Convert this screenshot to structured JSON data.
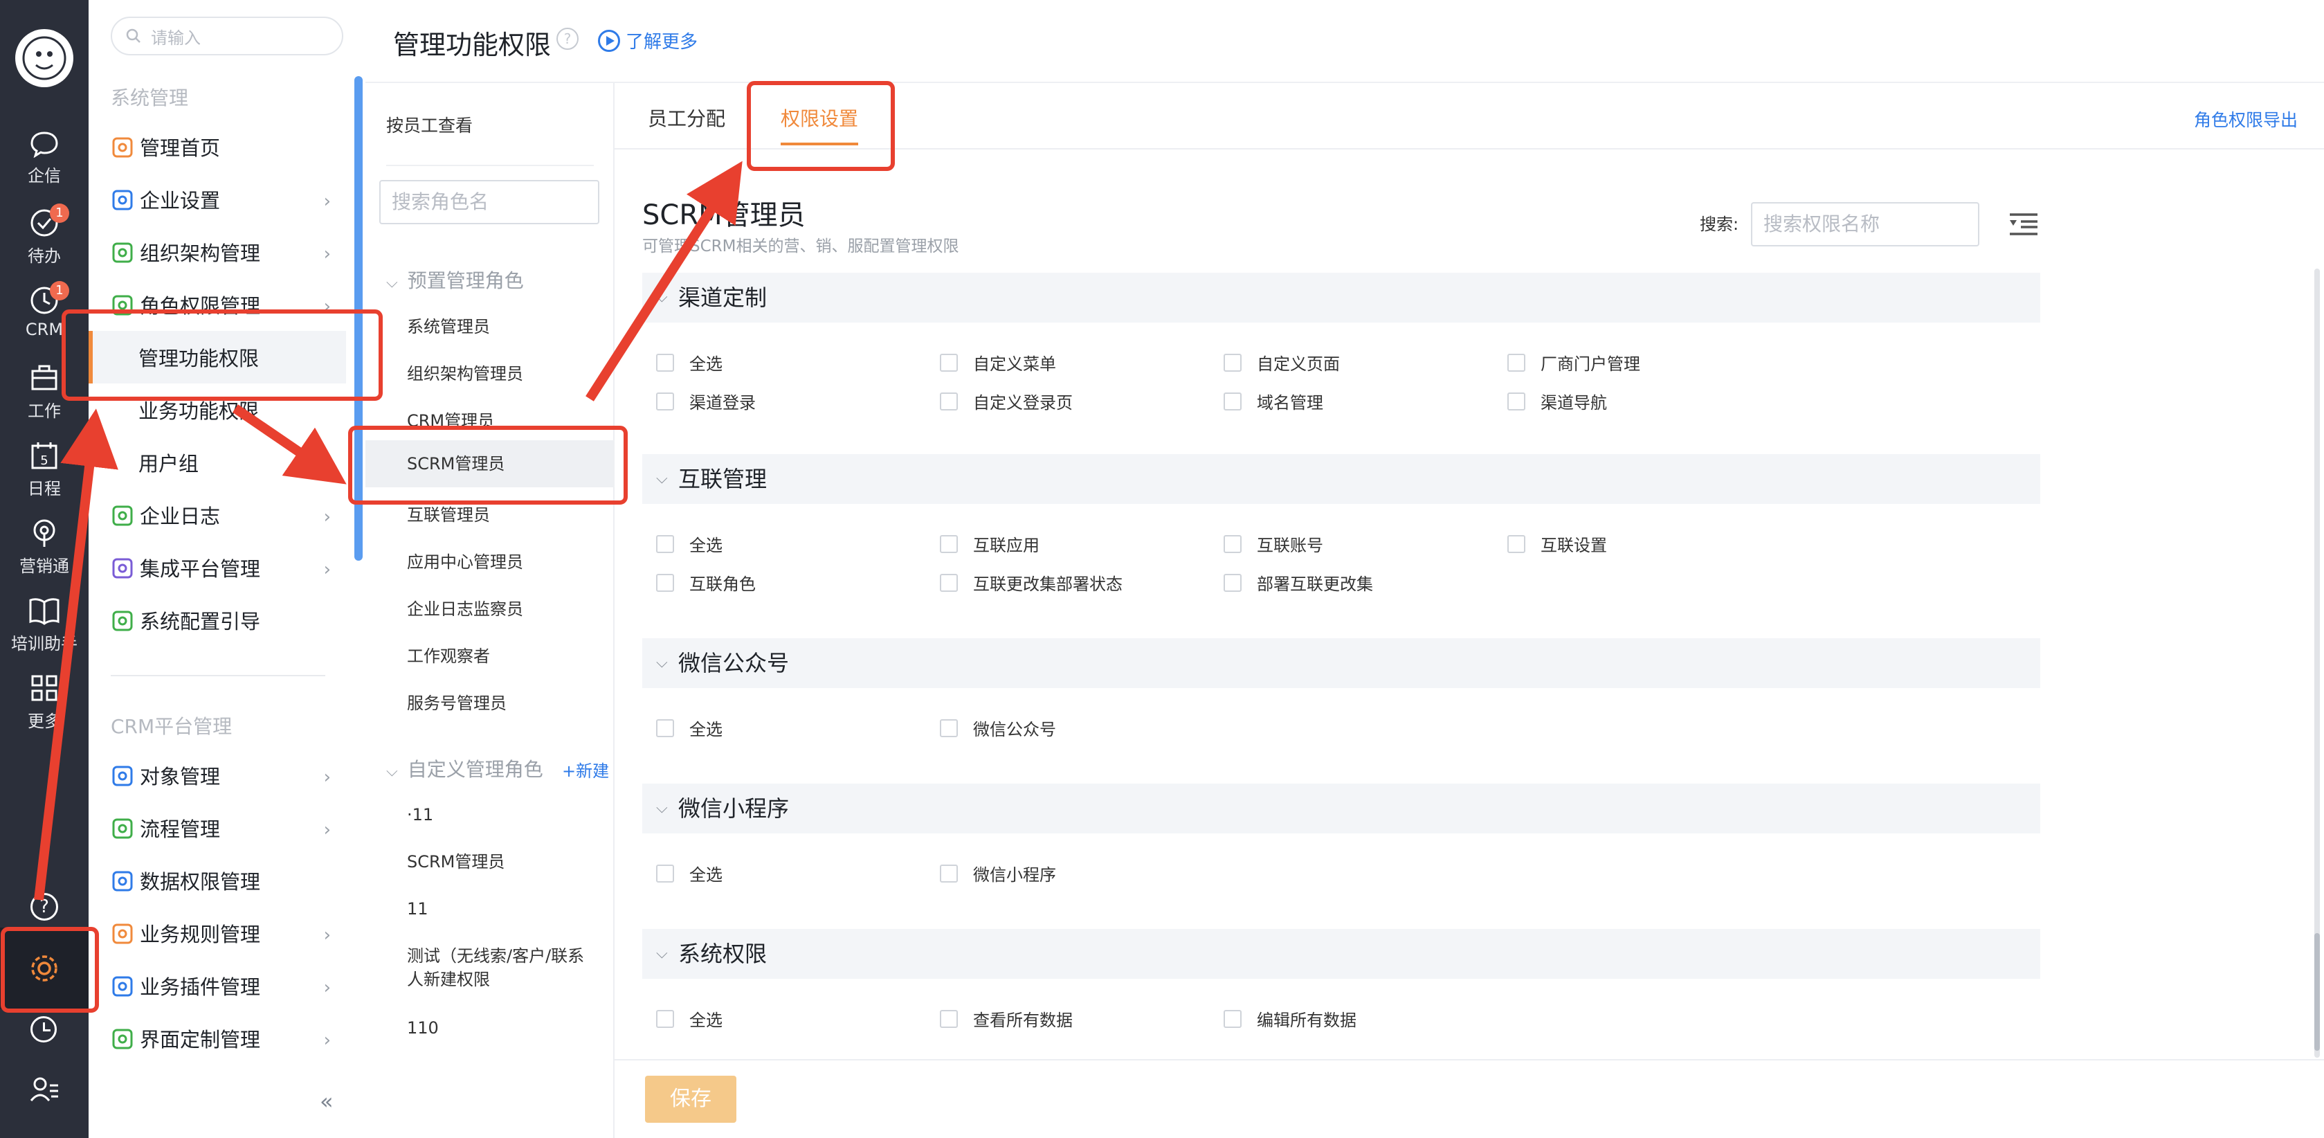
{
  "rail": {
    "items": [
      {
        "icon": "chat-bubble-icon",
        "label": "企信",
        "badge": ""
      },
      {
        "icon": "checkmark-circle-icon",
        "label": "待办",
        "badge": "1"
      },
      {
        "icon": "clock-icon",
        "label": "CRM",
        "badge": "1"
      },
      {
        "icon": "briefcase-icon",
        "label": "工作",
        "badge": ""
      },
      {
        "icon": "calendar-icon",
        "label": "日程",
        "badge": ""
      },
      {
        "icon": "broadcast-icon",
        "label": "营销通",
        "badge": ""
      },
      {
        "icon": "book-icon",
        "label": "培训助手",
        "badge": ""
      },
      {
        "icon": "grid-icon",
        "label": "更多",
        "badge": ""
      }
    ],
    "calendar_day": "5"
  },
  "sidenav": {
    "search_placeholder": "请输入",
    "group1_title": "系统管理",
    "group1_items": [
      {
        "label": "管理首页",
        "icon": "home-icon",
        "chevron": false
      },
      {
        "label": "企业设置",
        "icon": "building-icon",
        "chevron": true
      },
      {
        "label": "组织架构管理",
        "icon": "org-tree-icon",
        "chevron": true
      },
      {
        "label": "角色权限管理",
        "icon": "role-icon",
        "chevron": true
      }
    ],
    "sub_items": [
      "管理功能权限",
      "业务功能权限",
      "用户组"
    ],
    "group1_rest": [
      {
        "label": "企业日志",
        "icon": "log-icon",
        "chevron": true
      },
      {
        "label": "集成平台管理",
        "icon": "chip-icon",
        "chevron": true
      },
      {
        "label": "系统配置引导",
        "icon": "signpost-icon",
        "chevron": false
      }
    ],
    "group2_title": "CRM平台管理",
    "group2_items": [
      {
        "label": "对象管理",
        "icon": "cube-icon",
        "chevron": true
      },
      {
        "label": "流程管理",
        "icon": "flow-icon",
        "chevron": true
      },
      {
        "label": "数据权限管理",
        "icon": "data-lock-icon",
        "chevron": false
      },
      {
        "label": "业务规则管理",
        "icon": "wrench-icon",
        "chevron": true
      },
      {
        "label": "业务插件管理",
        "icon": "plugin-icon",
        "chevron": true
      },
      {
        "label": "界面定制管理",
        "icon": "layout-icon",
        "chevron": true
      }
    ],
    "collapse_glyph": "«"
  },
  "header": {
    "title": "管理功能权限",
    "help_glyph": "?",
    "learn_more": "了解更多"
  },
  "roles": {
    "view_by_employee": "按员工查看",
    "search_placeholder": "搜索角色名",
    "preset_title": "预置管理角色",
    "preset": [
      "系统管理员",
      "组织架构管理员",
      "CRM管理员",
      "SCRM管理员",
      "互联管理员",
      "应用中心管理员",
      "企业日志监察员",
      "工作观察者",
      "服务号管理员"
    ],
    "custom_title": "自定义管理角色",
    "new_label": "+新建",
    "custom": [
      "·11",
      "SCRM管理员",
      "11",
      "测试（无线索/客户/联系人新建权限",
      "110"
    ]
  },
  "main": {
    "tabs": [
      "员工分配",
      "权限设置"
    ],
    "export_label": "角色权限导出",
    "role_title": "SCRM管理员",
    "role_desc": "可管理SCRM相关的营、销、服配置管理权限",
    "search_label": "搜索:",
    "search_placeholder": "搜索权限名称",
    "sections": [
      {
        "title": "渠道定制",
        "items": [
          "全选",
          "自定义菜单",
          "自定义页面",
          "厂商门户管理",
          "渠道登录",
          "自定义登录页",
          "域名管理",
          "渠道导航"
        ]
      },
      {
        "title": "互联管理",
        "items": [
          "全选",
          "互联应用",
          "互联账号",
          "互联设置",
          "互联角色",
          "互联更改集部署状态",
          "部署互联更改集"
        ]
      },
      {
        "title": "微信公众号",
        "items": [
          "全选",
          "微信公众号"
        ]
      },
      {
        "title": "微信小程序",
        "items": [
          "全选",
          "微信小程序"
        ]
      },
      {
        "title": "系统权限",
        "items": [
          "全选",
          "查看所有数据",
          "编辑所有数据"
        ]
      }
    ],
    "save_label": "保存"
  },
  "colors": {
    "accent_orange": "#f0893b",
    "link_blue": "#2f7be8",
    "annotation_red": "#e8402f",
    "rail_bg": "#2b2f3a"
  }
}
